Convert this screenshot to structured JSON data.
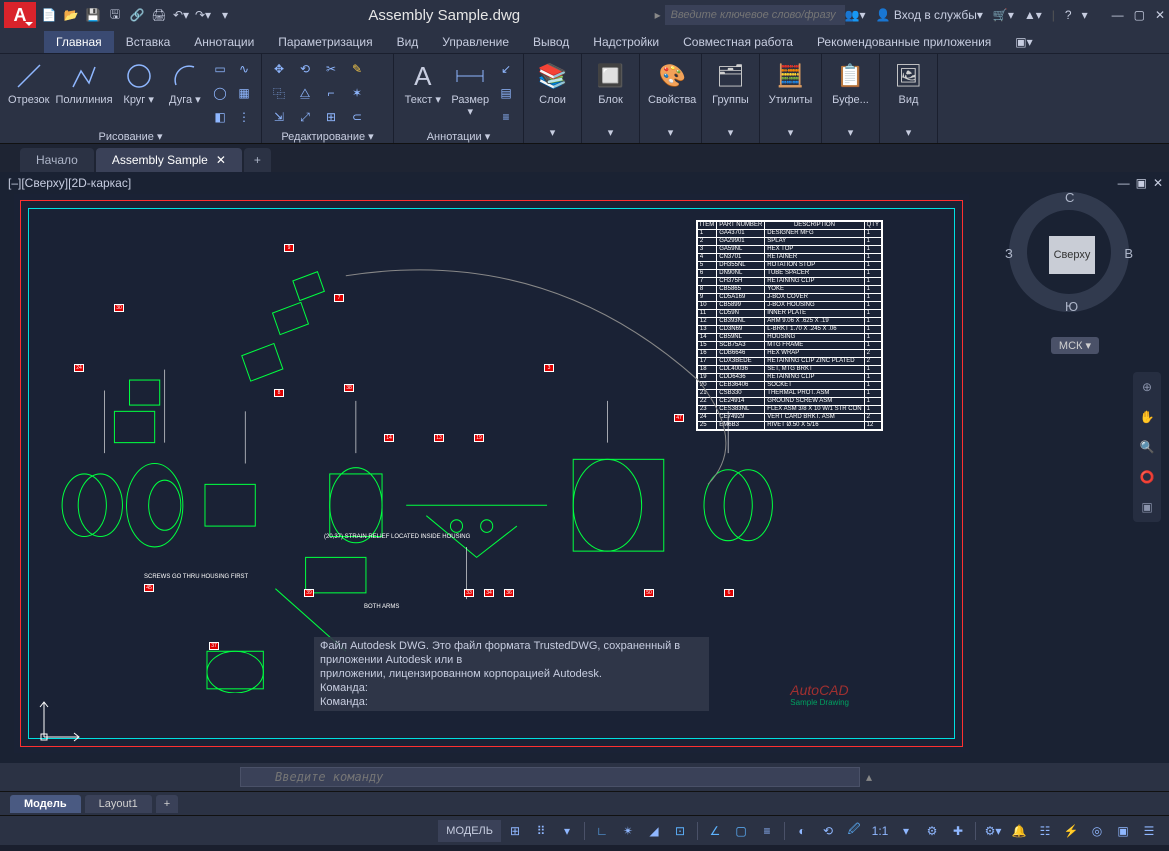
{
  "app": {
    "logo_letter": "A",
    "title": "Assembly Sample.dwg"
  },
  "qat": [
    "new",
    "open",
    "save",
    "saveas",
    "plot",
    "undo",
    "redo"
  ],
  "search": {
    "placeholder": "Введите ключевое слово/фразу"
  },
  "title_right": {
    "signin": "Вход в службы",
    "help": "?"
  },
  "menu": {
    "tabs": [
      "Главная",
      "Вставка",
      "Аннотации",
      "Параметризация",
      "Вид",
      "Управление",
      "Вывод",
      "Надстройки",
      "Совместная работа",
      "Рекомендованные приложения"
    ],
    "active": 0
  },
  "ribbon": {
    "draw": {
      "title": "Рисование  ▾",
      "tools": [
        {
          "label": "Отрезок"
        },
        {
          "label": "Полилиния"
        },
        {
          "label": "Круг"
        },
        {
          "label": "Дуга"
        }
      ]
    },
    "modify": {
      "title": "Редактирование  ▾"
    },
    "annot": {
      "title": "Аннотации  ▾",
      "tools": [
        {
          "label": "Текст"
        },
        {
          "label": "Размер"
        }
      ]
    },
    "layers": {
      "title": "Слои"
    },
    "block": {
      "title": "Блок"
    },
    "props": {
      "title": "Свойства"
    },
    "groups": {
      "title": "Группы"
    },
    "utils": {
      "title": "Утилиты"
    },
    "clip": {
      "title": "Буфе..."
    },
    "view": {
      "title": "Вид"
    }
  },
  "doc_tabs": {
    "start": "Начало",
    "active": "Assembly Sample"
  },
  "viewport": {
    "label": "[–][Сверху][2D-каркас]",
    "cube_face": "Сверху",
    "cube_n": "С",
    "cube_s": "Ю",
    "cube_e": "В",
    "cube_w": "З",
    "wcs": "МСК  ▾"
  },
  "bom": {
    "headers": [
      "ITEM",
      "PART NUMBER",
      "DESCRIPTION",
      "QTY"
    ],
    "rows": [
      [
        "1",
        "GA43701",
        "DESIGNER MFG",
        "1"
      ],
      [
        "2",
        "GA29901",
        "SPLAY",
        "1"
      ],
      [
        "3",
        "GA59NL",
        "HEX TOP",
        "1"
      ],
      [
        "4",
        "CN3701",
        "RETAINER",
        "1"
      ],
      [
        "5",
        "DH355NL",
        "ROTATION STOP",
        "1"
      ],
      [
        "6",
        "DN90NL",
        "TUBE SPACER",
        "1"
      ],
      [
        "7",
        "CH375H",
        "RETAINING CLIP",
        "1"
      ],
      [
        "8",
        "CB5865",
        "YOKE",
        "1"
      ],
      [
        "9",
        "CD5A169",
        "J-BOX COVER",
        "1"
      ],
      [
        "10",
        "CB5899",
        "J-BOX HOUSING",
        "1"
      ],
      [
        "11",
        "CD59N",
        "INNER PLATE",
        "1"
      ],
      [
        "12",
        "CB393NL",
        "ARM 9.06 X .625 X .19",
        "1"
      ],
      [
        "13",
        "CD3N69",
        "L-BRKT 1.70 X .245 X .06",
        "1"
      ],
      [
        "14",
        "CB59NL",
        "HOUSING",
        "1"
      ],
      [
        "15",
        "SCB75A3",
        "MTG FRAME",
        "1"
      ],
      [
        "16",
        "CDB6646",
        "HEX WRAP",
        "2"
      ],
      [
        "17",
        "CDX3BEDE",
        "RETAINING CLIP ZINC PLATED",
        "2"
      ],
      [
        "18",
        "CDL40036",
        "SET, MTG BRKT",
        "1"
      ],
      [
        "19",
        "CDD6436",
        "RETAINING CLIP",
        "1"
      ],
      [
        "20",
        "CEB36406",
        "SOCKET",
        "1"
      ],
      [
        "21",
        "CSB330",
        "THERMAL PROT. ASM",
        "1"
      ],
      [
        "22",
        "CE24914",
        "GROUND SCREW ASM",
        "1"
      ],
      [
        "23",
        "CES383NL",
        "FLEX ASM 3/8 X 10 W/1 STR CON",
        "1"
      ],
      [
        "24",
        "CE74929",
        "VERT CARD BRKT. ASM",
        "2"
      ],
      [
        "25",
        "EM6B3",
        "RIVET Ø.50 X 5/16",
        "12"
      ]
    ]
  },
  "notes": {
    "arm": "BOTH\nARMS",
    "screws": "SCREWS GO THRU\nHOUSING FIRST",
    "strain": "(20,37)\nSTRAIN RELIEF\nLOCATED INSIDE\nHOUSING"
  },
  "cmd_overlay": {
    "line1": "Файл Autodesk DWG. Это файл формата TrustedDWG, сохраненный в приложении Autodesk или в",
    "line2": "приложении, лицензированном корпорацией Autodesk.",
    "prompt": "Команда:"
  },
  "stamp": {
    "brand": "AutoCAD",
    "sub": "Sample Drawing"
  },
  "cmdline": {
    "placeholder": "Введите команду",
    "prefix": ">_"
  },
  "layout_tabs": {
    "model": "Модель",
    "layout1": "Layout1"
  },
  "status": {
    "model": "МОДЕЛЬ",
    "scale": "1:1"
  }
}
